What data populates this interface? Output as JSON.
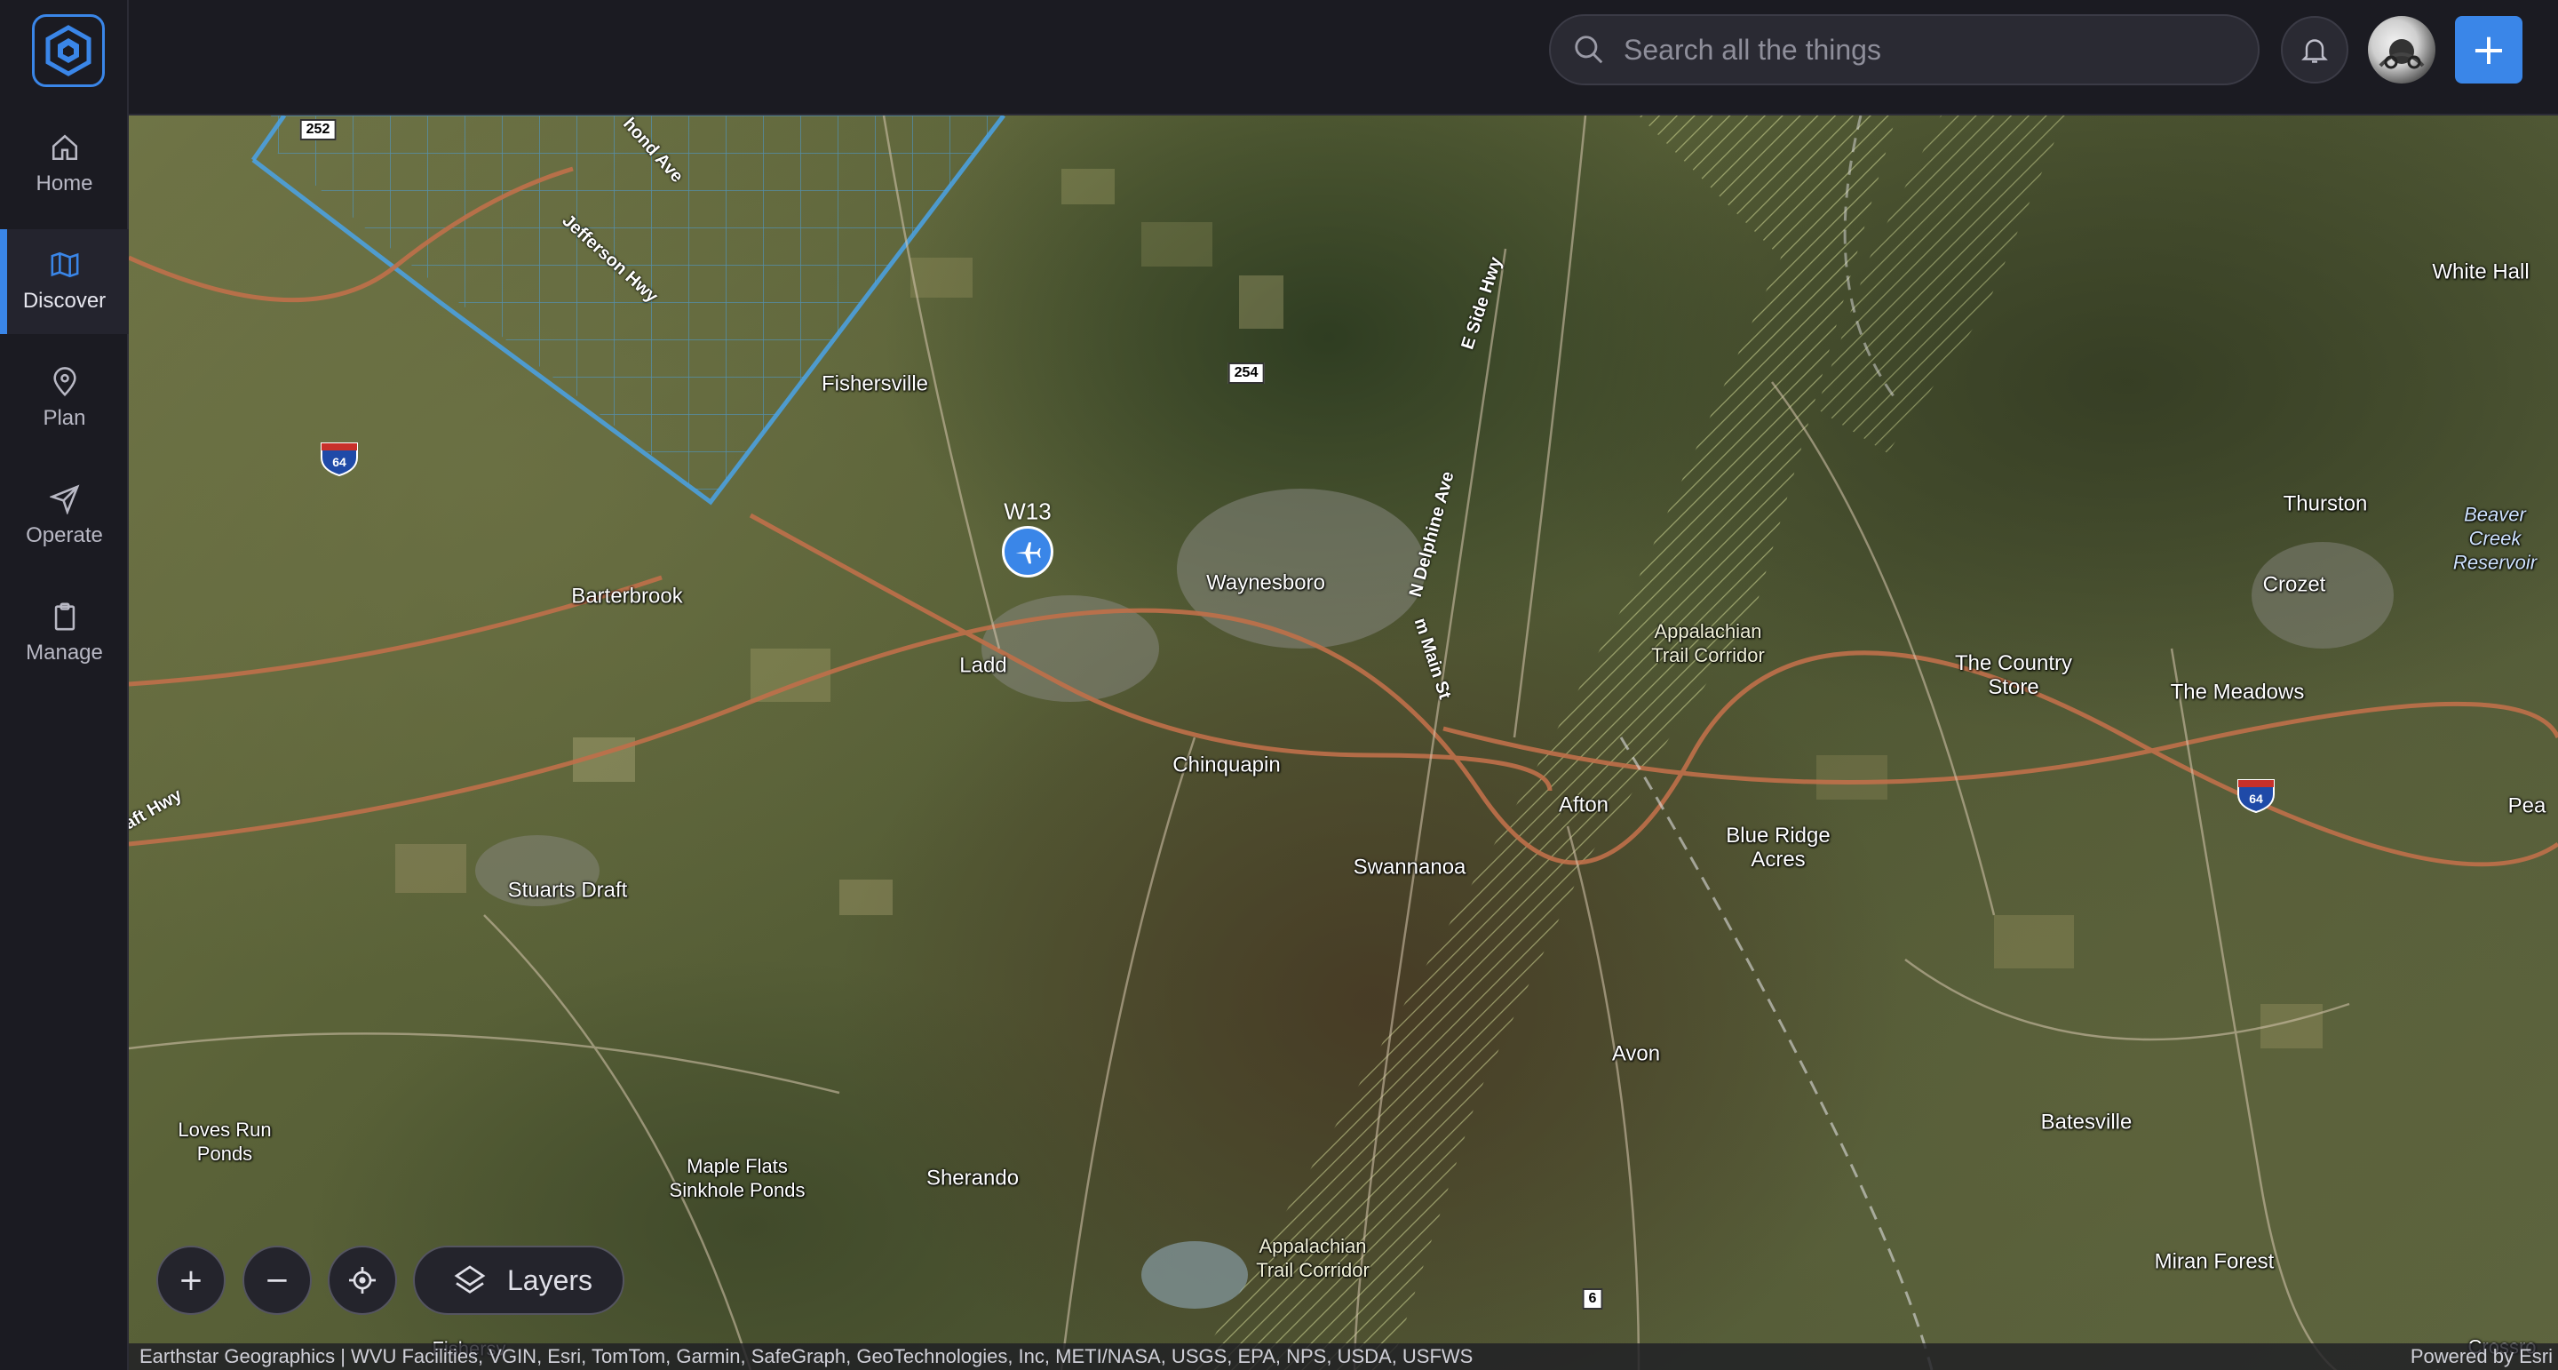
{
  "sidebar": {
    "items": [
      {
        "label": "Home",
        "icon": "home-icon"
      },
      {
        "label": "Discover",
        "icon": "map-icon",
        "active": true
      },
      {
        "label": "Plan",
        "icon": "map-pin-icon"
      },
      {
        "label": "Operate",
        "icon": "send-icon"
      },
      {
        "label": "Manage",
        "icon": "clipboard-icon"
      }
    ]
  },
  "header": {
    "search_placeholder": "Search all the things",
    "add_label": "+"
  },
  "map": {
    "places": {
      "fishersville": "Fishersville",
      "barterbrook": "Barterbrook",
      "waynesboro": "Waynesboro",
      "ladd": "Ladd",
      "chinquapin": "Chinquapin",
      "swannanoa": "Swannanoa",
      "afton": "Afton",
      "blue_ridge_acres": "Blue Ridge\nAcres",
      "stuarts_draft": "Stuarts Draft",
      "avon": "Avon",
      "sherando": "Sherando",
      "loves_run_ponds": "Loves Run\nPonds",
      "maple_flats": "Maple Flats\nSinkhole Ponds",
      "appalachian_1": "Appalachian\nTrail Corridor",
      "appalachian_2": "Appalachian\nTrail Corridor",
      "the_country_store": "The Country\nStore",
      "thurston": "Thurston",
      "crozet": "Crozet",
      "the_meadows": "The Meadows",
      "white_hall": "White Hall",
      "beaver_creek": "Beaver\nCreek\nReservoir",
      "batesville": "Batesville",
      "miran_forest": "Miran Forest",
      "pea": "Pea",
      "crossroads": "Crossro",
      "fishersville_bottom": "Fishersv"
    },
    "roads": {
      "jefferson_hwy": "Jefferson Hwy",
      "richmond_ave": "hond Ave",
      "e_side_hwy": "E Side Hwy",
      "n_delphine": "N Delphine Ave",
      "main_st": "m Main St",
      "craft_hwy": "aft Hwy"
    },
    "shields": {
      "r252": "252",
      "r254": "254",
      "r6": "6",
      "i64a": "64",
      "i64b": "64"
    },
    "airport": {
      "label": "W13",
      "icon": "airplane-icon"
    },
    "controls": {
      "zoom_in": "+",
      "zoom_out": "−",
      "layers": "Layers"
    },
    "attribution": "Earthstar Geographics | WVU Facilities, VGIN, Esri, TomTom, Garmin, SafeGraph, GeoTechnologies, Inc, METI/NASA, USGS, EPA, NPS, USDA, USFWS",
    "powered_by": "Powered by Esri",
    "colors": {
      "accent": "#3a86e8",
      "road": "#c0704a",
      "airspace": "#4aa3e8"
    }
  }
}
